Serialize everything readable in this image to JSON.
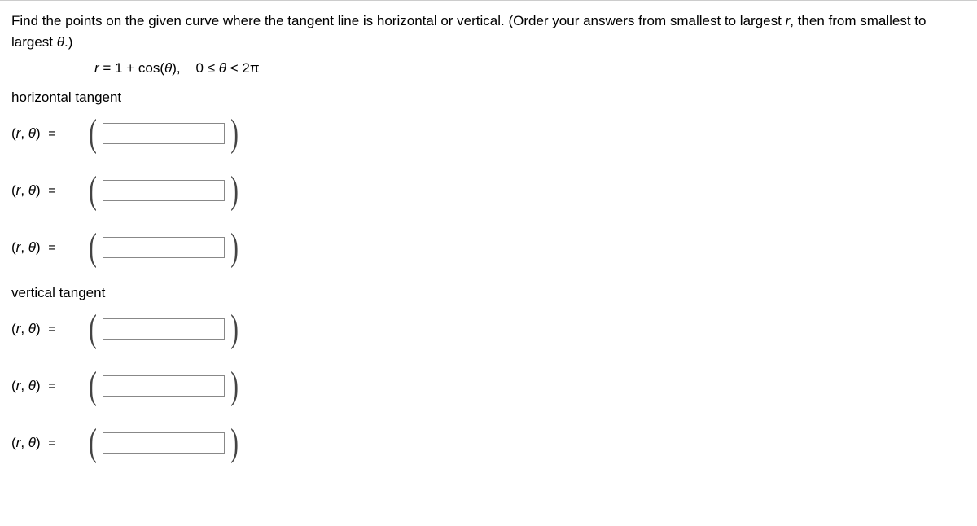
{
  "question": {
    "line1": "Find the points on the given curve where the tangent line is horizontal or vertical. (Order your answers from smallest to largest ",
    "var_r": "r",
    "line1b": ", then from smallest to largest ",
    "var_theta": "θ",
    "line1c": ".)"
  },
  "equation": {
    "lhs": "r",
    "eq": " = 1 + cos(",
    "theta": "θ",
    "close": "),",
    "range_pre": "0 ≤ ",
    "range_theta": "θ",
    "range_post": " < 2π"
  },
  "sections": {
    "horizontal_label": "horizontal tangent",
    "vertical_label": "vertical tangent"
  },
  "row_label": {
    "open": "(",
    "r": "r",
    "comma": ", ",
    "theta": "θ",
    "close": ")",
    "equals": "="
  },
  "answers": {
    "horizontal": [
      "",
      "",
      ""
    ],
    "vertical": [
      "",
      "",
      ""
    ]
  }
}
